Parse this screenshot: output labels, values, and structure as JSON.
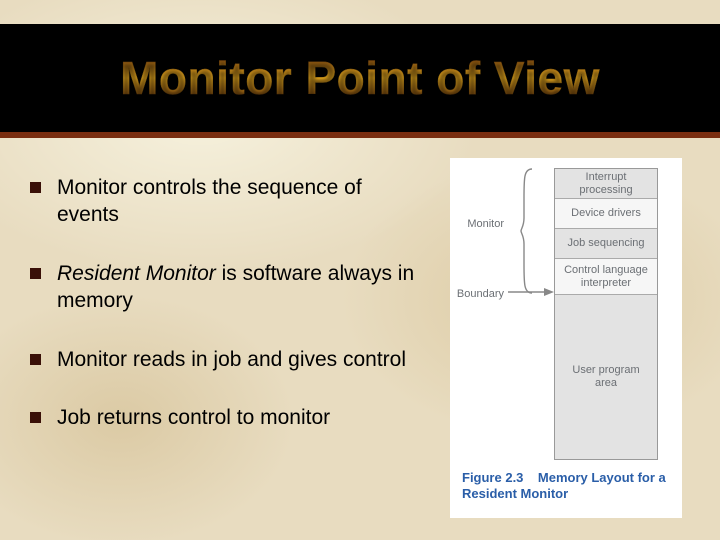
{
  "title": "Monitor Point of View",
  "bullets": [
    {
      "html": "Monitor controls the sequence of events"
    },
    {
      "html": "<em>Resident Monitor</em> is software always in memory"
    },
    {
      "html": "Monitor reads in job and gives control"
    },
    {
      "html": "Job returns control to monitor"
    }
  ],
  "figure": {
    "labels": {
      "monitor": "Monitor",
      "boundary": "Boundary"
    },
    "boxes": {
      "interrupt": "Interrupt\nprocessing",
      "device": "Device\ndrivers",
      "jobseq": "Job\nsequencing",
      "cli": "Control language\ninterpreter",
      "user": "User\nprogram\narea"
    },
    "caption_fig": "Figure 2.3",
    "caption_title": "Memory Layout for a Resident Monitor"
  }
}
